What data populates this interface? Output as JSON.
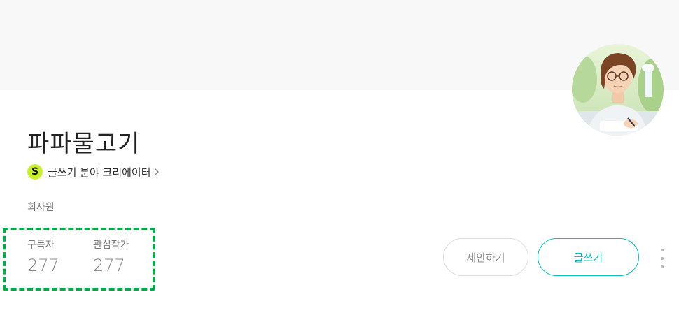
{
  "profile": {
    "name": "파파물고기",
    "creator_badge": "S",
    "creator_label": "글쓰기 분야 크리에이터",
    "job": "회사원"
  },
  "stats": {
    "subscribers_label": "구독자",
    "subscribers_value": "277",
    "following_label": "관심작가",
    "following_value": "277"
  },
  "actions": {
    "suggest_label": "제안하기",
    "write_label": "글쓰기"
  },
  "colors": {
    "cover_background": "#f8f8f8",
    "creator_badge": "#c8f02a",
    "accent": "#00c3bd",
    "highlight_border": "#0aa84a"
  },
  "icons": {
    "creator_chevron": "chevron-right-icon",
    "more": "more-vertical-icon"
  }
}
